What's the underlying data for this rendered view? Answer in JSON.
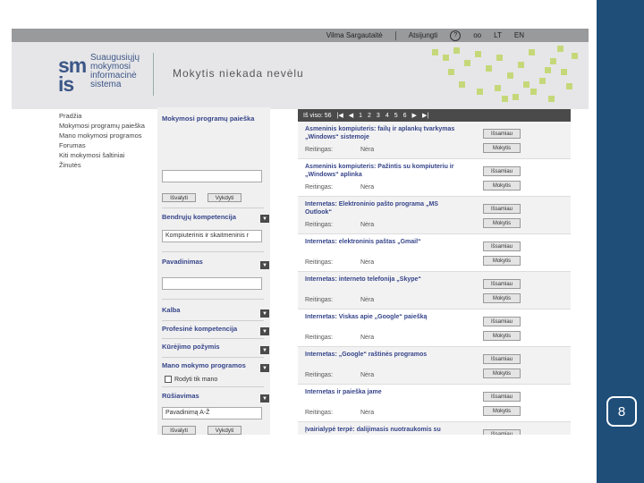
{
  "topbar": {
    "user": "Vilma Sargautaitė",
    "logout": "Atsijungti",
    "help": "?",
    "glasses": "oo",
    "lang_lt": "LT",
    "lang_en": "EN"
  },
  "header": {
    "logo_top": "sm",
    "logo_bottom": "is",
    "logo_lines": [
      "Suaugusiųjų",
      "mokymosi",
      "informacinė",
      "sistema"
    ],
    "slogan": "Mokytis niekada nevėlu",
    "accent_color": "#b7d24a"
  },
  "left_menu": [
    "Pradžia",
    "Mokymosi programų paieška",
    "Mano mokymosi programos",
    "Forumas",
    "Kiti mokymosi šaltiniai",
    "Žinutės"
  ],
  "filter": {
    "title": "Mokymosi programų paieška",
    "search_value": "",
    "btn_clear": "Išvalyti",
    "btn_search": "Vykdyti",
    "sections": {
      "general": "Bendrųjų kompetencija",
      "general_value": "Kompiuterinis ir skaitmeninis r",
      "name": "Pavadinimas",
      "name_value": "",
      "language": "Kalba",
      "professional": "Profesinė kompetencija",
      "approach": "Kūrėjimo požymis",
      "my_programs": "Mano mokymo programos",
      "show_mine": "Rodyti tik mano",
      "sorting": "Rūšiavimas",
      "sorting_value": "Pavadinimą A-Ž"
    },
    "arrow_glyph": "▼"
  },
  "results": {
    "header": [
      "Iš viso: 56",
      "|◀",
      "◀",
      "1",
      "2",
      "3",
      "4",
      "5",
      "6",
      "▶",
      "▶|"
    ],
    "fee_label": "Reitingas:",
    "btn_view": "Išsamiau",
    "btn_learn": "Mokytis",
    "items": [
      {
        "title": "Asmeninis kompiuteris: failų ir aplankų tvarkymas „Windows“ sistemoje",
        "fee": "Nėra"
      },
      {
        "title": "Asmeninis kompiuteris: Pažintis su kompiuteriu ir „Windows“ aplinka",
        "fee": "Nėra"
      },
      {
        "title": "Internetas: Elektroninio pašto programa „MS Outlook“",
        "fee": "Nėra"
      },
      {
        "title": "Internetas: elektroninis paštas „Gmail“",
        "fee": "Nėra"
      },
      {
        "title": "Internetas: interneto telefonija „Skype“",
        "fee": "Nėra"
      },
      {
        "title": "Internetas: Viskas apie „Google“ paiešką",
        "fee": "Nėra"
      },
      {
        "title": "Internetas: „Google“ raštinės programos",
        "fee": "Nėra"
      },
      {
        "title": "Internetas ir paieška jame",
        "fee": "Nėra"
      },
      {
        "title": "Įvairialypė terpė: dalijimasis nuotraukomis su programa „Picasa“",
        "fee": ""
      }
    ]
  },
  "slide": {
    "page_number": "8",
    "bar_color": "#1f4e79"
  }
}
